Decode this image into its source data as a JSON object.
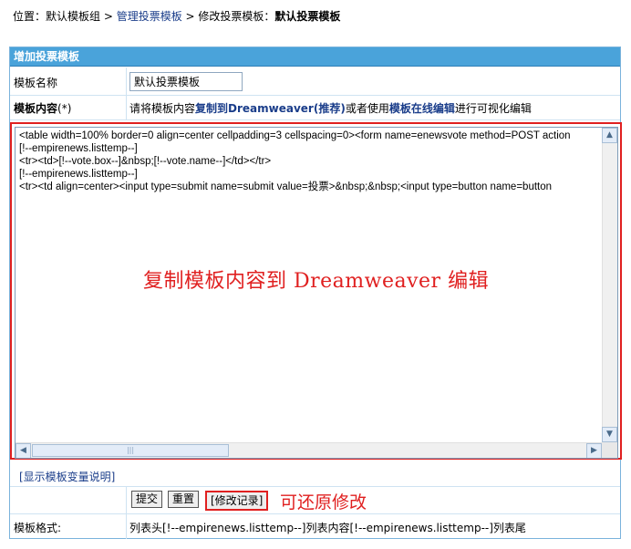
{
  "breadcrumb": {
    "prefix": "位置：默认模板组 > ",
    "manage_link": "管理投票模板",
    "middle": " > 修改投票模板：",
    "current": "默认投票模板"
  },
  "panel": {
    "title": "增加投票模板",
    "name_label": "模板名称",
    "name_value": "默认投票模板",
    "content_label": "模板内容",
    "required_mark": "(*)",
    "hint_prefix": "请将模板内容",
    "hint_copy_link": "复制到Dreamweaver(推荐)",
    "hint_middle": "或者使用",
    "hint_online_link": "模板在线编辑",
    "hint_suffix": "进行可视化编辑",
    "editor_content": "<table width=100% border=0 align=center cellpadding=3 cellspacing=0><form name=enewsvote method=POST action\n[!--empirenews.listtemp--]\n<tr><td>[!--vote.box--]&nbsp;[!--vote.name--]</td></tr>\n[!--empirenews.listtemp--]\n<tr><td align=center><input type=submit name=submit value=投票>&nbsp;&nbsp;<input type=button name=button",
    "overlay_note": "复制模板内容到 Dreamweaver 编辑",
    "show_vars_link": "[显示模板变量说明]",
    "submit_label": "提交",
    "reset_label": "重置",
    "log_label": "[修改记录]",
    "restore_note": "可还原修改",
    "format_label": "模板格式:",
    "format_value": "列表头[!--empirenews.listtemp--]列表内容[!--empirenews.listtemp--]列表尾"
  },
  "colors": {
    "header_bg": "#4aa3da",
    "link": "#1a3d8a",
    "annotation_red": "#e02020",
    "border": "#7ab3dc"
  }
}
